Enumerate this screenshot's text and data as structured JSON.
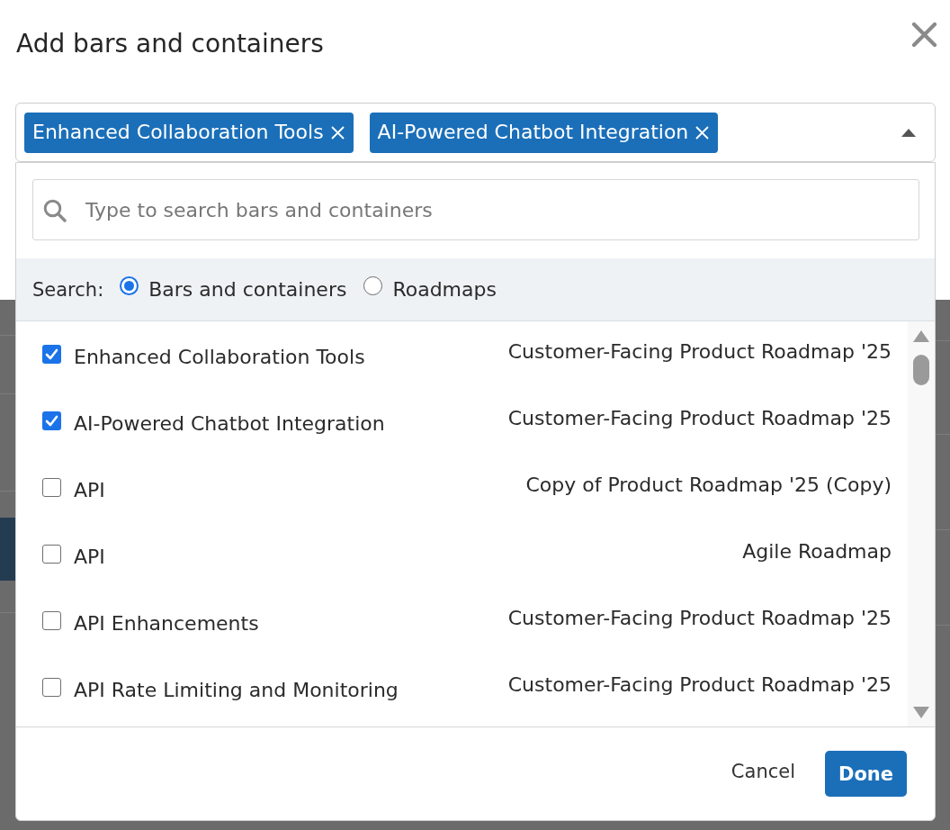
{
  "dialog": {
    "title": "Add bars and containers"
  },
  "selector": {
    "expanded": true,
    "tags": [
      {
        "label": "Enhanced Collaboration Tools"
      },
      {
        "label": "AI-Powered Chatbot Integration"
      }
    ]
  },
  "dropdown": {
    "search": {
      "placeholder": "Type to search bars and containers"
    },
    "scope": {
      "label": "Search:",
      "options": [
        {
          "label": "Bars and containers",
          "selected": true
        },
        {
          "label": "Roadmaps",
          "selected": false
        }
      ]
    },
    "items": [
      {
        "name": "Enhanced Collaboration Tools",
        "roadmap": "Customer-Facing Product Roadmap '25",
        "checked": true
      },
      {
        "name": "AI-Powered Chatbot Integration",
        "roadmap": "Customer-Facing Product Roadmap '25",
        "checked": true
      },
      {
        "name": "API",
        "roadmap": "Copy of Product Roadmap '25 (Copy)",
        "checked": false
      },
      {
        "name": "API",
        "roadmap": "Agile Roadmap",
        "checked": false
      },
      {
        "name": "API Enhancements",
        "roadmap": "Customer-Facing Product Roadmap '25",
        "checked": false
      },
      {
        "name": "API Rate Limiting and Monitoring",
        "roadmap": "Customer-Facing Product Roadmap '25",
        "checked": false
      }
    ]
  },
  "footer": {
    "buttons": [
      {
        "label": "Cancel",
        "kind": "text"
      },
      {
        "label": "Done",
        "kind": "primary"
      }
    ]
  }
}
